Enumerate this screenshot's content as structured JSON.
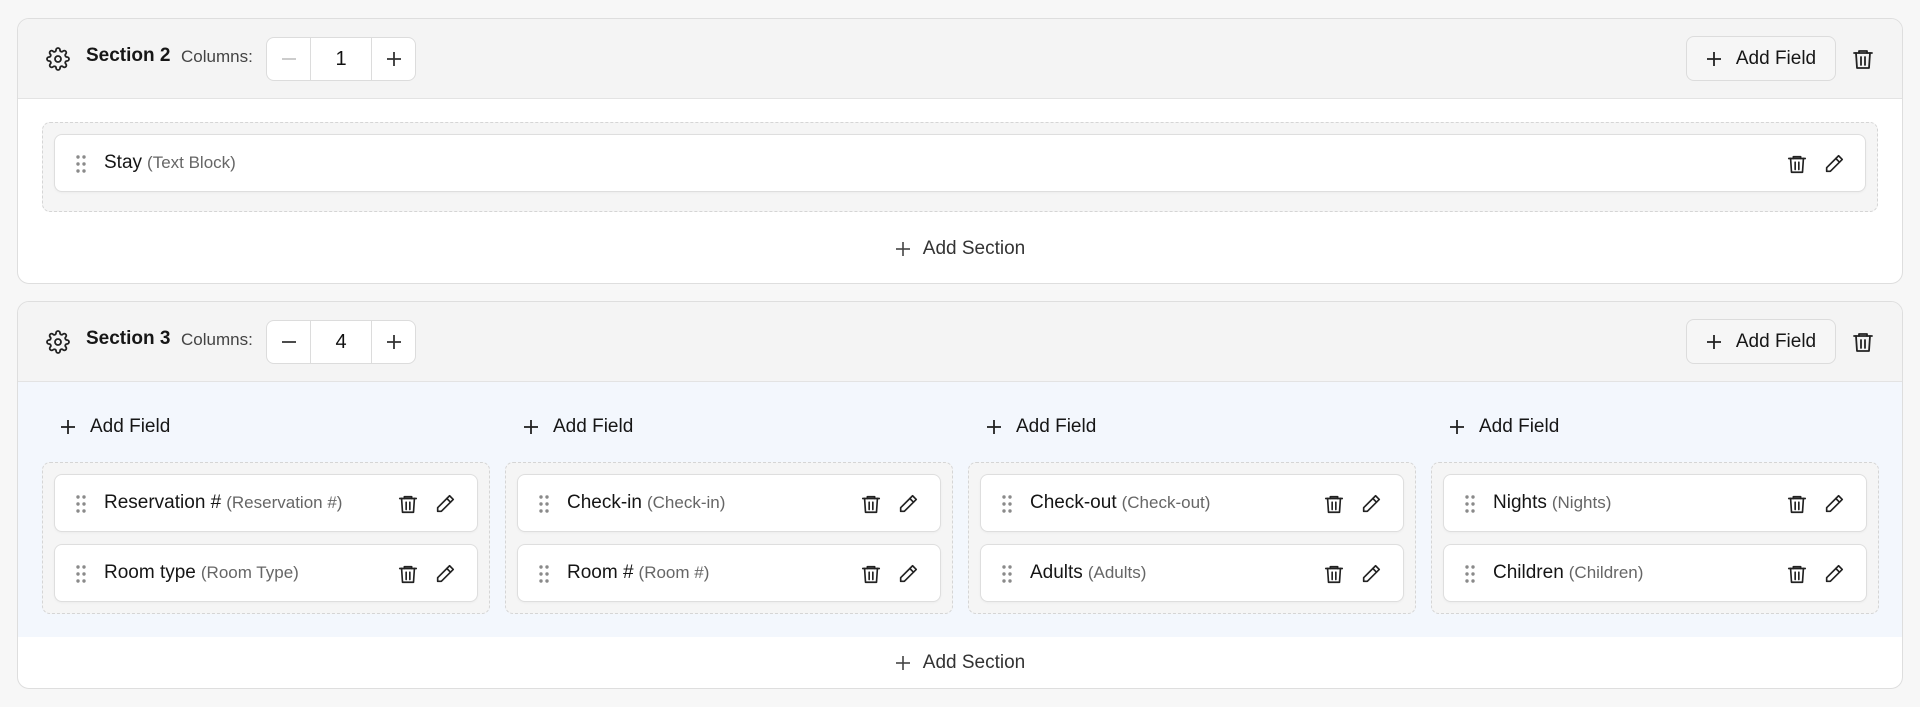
{
  "sections": [
    {
      "title": "Section 2",
      "columns_label": "Columns:",
      "columns_value": "1",
      "add_field_label": "Add Field",
      "fields": [
        {
          "name": "Stay",
          "type": "(Text Block)"
        }
      ],
      "add_section_label": "Add Section"
    },
    {
      "title": "Section 3",
      "columns_label": "Columns:",
      "columns_value": "4",
      "add_field_label": "Add Field",
      "columns": [
        {
          "add_field_label": "Add Field",
          "fields": [
            {
              "name": "Reservation #",
              "type": "(Reservation #)"
            },
            {
              "name": "Room type",
              "type": "(Room Type)"
            }
          ]
        },
        {
          "add_field_label": "Add Field",
          "fields": [
            {
              "name": "Check-in",
              "type": "(Check-in)"
            },
            {
              "name": "Room #",
              "type": "(Room #)"
            }
          ]
        },
        {
          "add_field_label": "Add Field",
          "fields": [
            {
              "name": "Check-out",
              "type": "(Check-out)"
            },
            {
              "name": "Adults",
              "type": "(Adults)"
            }
          ]
        },
        {
          "add_field_label": "Add Field",
          "fields": [
            {
              "name": "Nights",
              "type": "(Nights)"
            },
            {
              "name": "Children",
              "type": "(Children)"
            }
          ]
        }
      ],
      "add_section_label": "Add Section"
    }
  ],
  "icons": {
    "section_settings": "gear-icon",
    "decrement": "minus-icon",
    "increment": "plus-icon",
    "delete": "trash-icon",
    "edit": "pencil-icon",
    "drag": "drag-handle-icon"
  },
  "colors": {
    "page_bg": "#f7f7f7",
    "header_bg": "#f4f4f4",
    "columns_area_bg": "#f3f7fd",
    "border": "#dedede"
  }
}
